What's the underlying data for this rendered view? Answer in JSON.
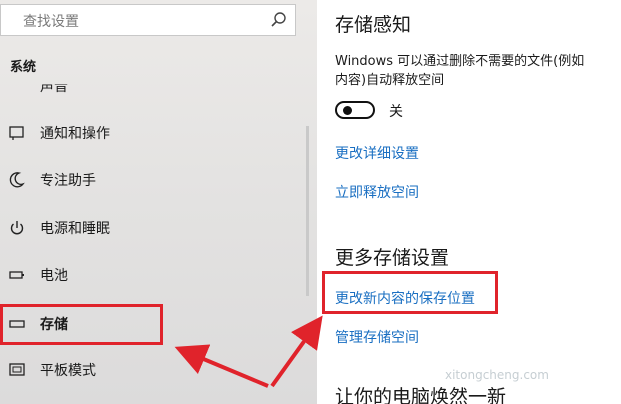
{
  "sidebar": {
    "search_placeholder": "查找设置",
    "section_title": "系统",
    "partial_item": "声音",
    "items": [
      {
        "label": "通知和操作",
        "icon": "notification-icon"
      },
      {
        "label": "专注助手",
        "icon": "moon-icon"
      },
      {
        "label": "电源和睡眠",
        "icon": "power-icon"
      },
      {
        "label": "电池",
        "icon": "battery-icon"
      },
      {
        "label": "存储",
        "icon": "storage-icon",
        "selected": true
      },
      {
        "label": "平板模式",
        "icon": "tablet-mode-icon"
      }
    ]
  },
  "content": {
    "storage_sense_title": "存储感知",
    "storage_sense_desc_line1": "Windows 可以通过删除不需要的文件(例如",
    "storage_sense_desc_line2": "内容)自动释放空间",
    "toggle_state": "关",
    "link_change_how": "更改详细设置",
    "link_free_space": "立即释放空间",
    "more_settings_title": "更多存储设置",
    "link_change_save_location": "更改新内容的保存位置",
    "link_manage_spaces": "管理存储空间",
    "bottom_title": "让你的电脑焕然一新"
  },
  "annotations": {
    "highlight_color": "#e0232b",
    "watermark": "xitongcheng.com"
  },
  "colors": {
    "link": "#1a6fc2",
    "sidebar_bg": "#e3e2e1"
  }
}
